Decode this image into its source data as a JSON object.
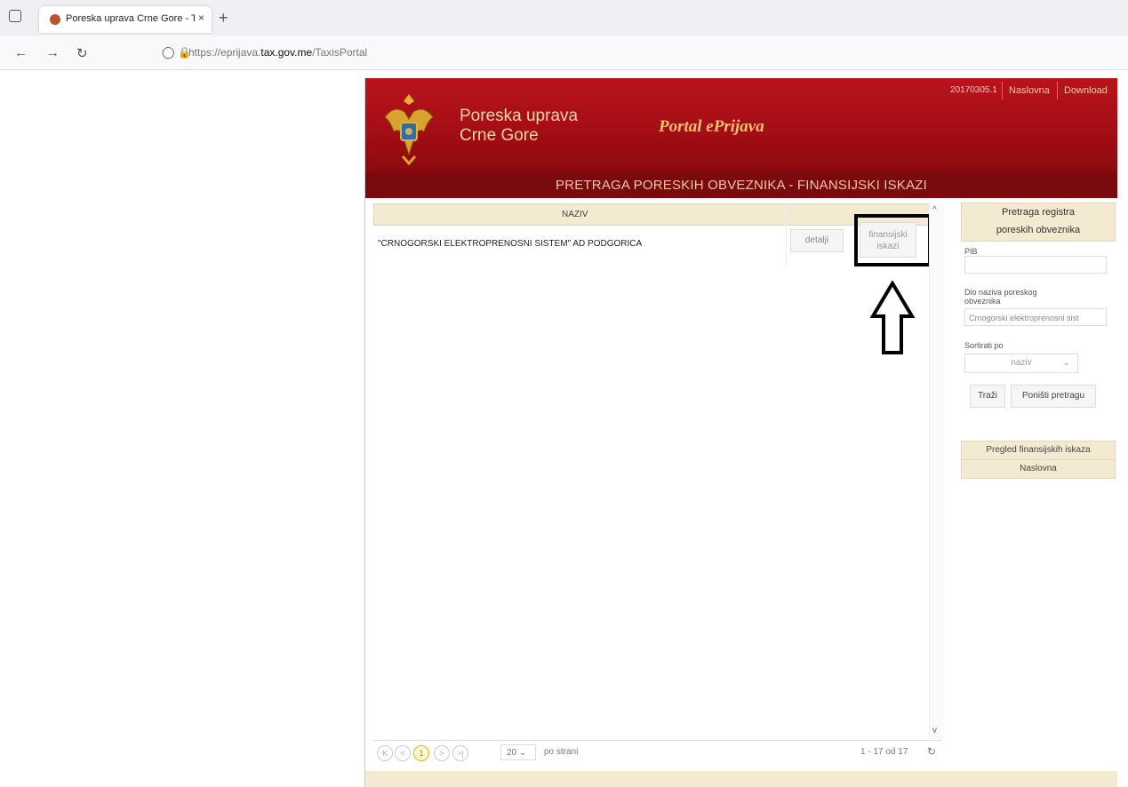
{
  "browser": {
    "tab_title": "Poreska uprava Crne Gore - Tax",
    "tab_close": "×",
    "new_tab": "+",
    "url_prefix": "https://eprijava.",
    "url_domain": "tax.gov.me",
    "url_path": "/TaxisPortal"
  },
  "banner": {
    "org_line1": "Poreska uprava",
    "org_line2": "Crne Gore",
    "portal_name": "Portal ePrijava",
    "version": "20170305.1",
    "link_home": "Naslovna",
    "link_download": "Download"
  },
  "page_title": "PRETRAGA PORESKIH OBVEZNIKA - FINANSIJSKI ISKAZI",
  "grid": {
    "column_naziv": "NAZIV",
    "rows": [
      {
        "naziv": "\"CRNOGORSKI ELEKTROPRENOSNI SISTEM\" AD PODGORICA",
        "btn_detalji": "detalji",
        "btn_fin_1": "finansijski",
        "btn_fin_2": "iskazi"
      }
    ]
  },
  "pager": {
    "first": "K",
    "prev": "<",
    "current_page": "1",
    "next": ">",
    "last": ">|",
    "page_size": "20",
    "per_page_label": "po strani",
    "range": "1 - 17 od 17"
  },
  "search_panel": {
    "title_line1": "Pretraga registra",
    "title_line2": "poreskih obveznika",
    "pib_label": "PIB",
    "pib_value": "",
    "name_label_1": "Dio naziva poreskog",
    "name_label_2": "obveznika",
    "name_value": "Crnogorski elektroprenosni sist",
    "sort_label": "Sortirati po",
    "sort_value": "naziv",
    "btn_search": "Traži",
    "btn_reset": "Poništi pretragu",
    "menu_fin": "Pregled finansijskih iskaza",
    "menu_home": "Naslovna"
  }
}
